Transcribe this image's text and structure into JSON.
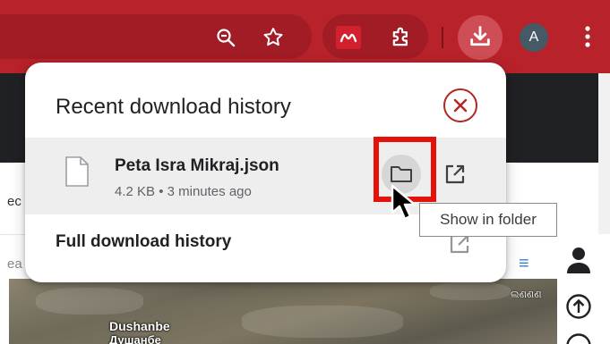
{
  "toolbar": {
    "zoom_icon": "zoom-out-icon",
    "bookmark_icon": "bookmark-star-icon",
    "extension_icon": "extensions-puzzle-icon",
    "download_icon": "download-icon",
    "avatar_initial": "A",
    "menu_icon": "kebab-menu-icon",
    "accent_color": "#b8222a"
  },
  "download_bubble": {
    "title": "Recent download history",
    "close_icon": "close-circle-icon",
    "items": [
      {
        "file_name": "Peta Isra Mikraj.json",
        "meta": "4.2 KB • 3 minutes ago",
        "file_icon": "file-icon",
        "show_in_folder_icon": "folder-icon",
        "open_icon": "open-external-icon"
      }
    ],
    "full_history_label": "Full download history"
  },
  "tooltip": {
    "text": "Show in folder"
  },
  "page": {
    "left_fragment_1": "ec",
    "left_fragment_2": "ea",
    "map_label_1": "Dushanbe",
    "map_label_2": "Душанбе",
    "map_corner_label": "ଲଣଣଣ"
  }
}
